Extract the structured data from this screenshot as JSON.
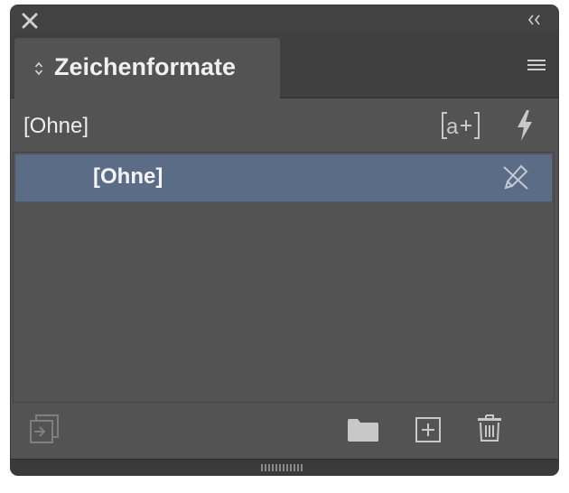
{
  "window": {
    "close_icon": "close-icon",
    "collapse_icon": "double-chevron-left-icon"
  },
  "tab": {
    "title": "Zeichenformate",
    "arrows_icon": "up-down-arrows-icon"
  },
  "panel_menu_icon": "hamburger-menu-icon",
  "toolbar": {
    "current_style": "[Ohne]",
    "new_style_group_icon": "bracket-a-plus-icon",
    "quick_apply_icon": "lightning-bolt-icon"
  },
  "list": {
    "items": [
      {
        "label": "[Ohne]",
        "selected": true,
        "status_icon": "no-edit-pencil-icon"
      }
    ]
  },
  "footer": {
    "load_icon": "load-styles-icon",
    "new_group_icon": "folder-icon",
    "new_style_icon": "plus-square-icon",
    "delete_icon": "trash-icon"
  },
  "colors": {
    "panel_bg": "#535353",
    "tab_bar_bg": "#3f3f3f",
    "selection": "#5b6c86",
    "text": "#eeeeee",
    "icon": "#c8c8c8"
  }
}
